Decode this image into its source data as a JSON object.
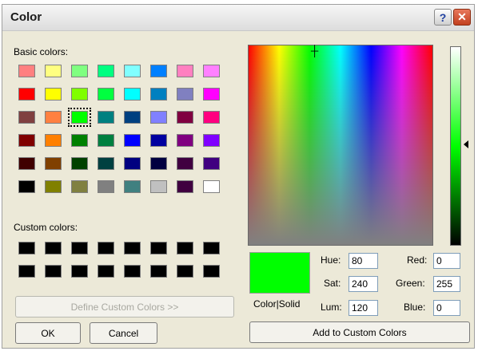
{
  "window": {
    "title": "Color"
  },
  "titlebar": {
    "help_glyph": "?",
    "close_glyph": "✕"
  },
  "basic_colors": {
    "label": "Basic colors:",
    "rows": [
      [
        "#ff8080",
        "#ffff80",
        "#80ff80",
        "#00ff80",
        "#80ffff",
        "#0080ff",
        "#ff80c0",
        "#ff80ff"
      ],
      [
        "#ff0000",
        "#ffff00",
        "#80ff00",
        "#00ff40",
        "#00ffff",
        "#0080c0",
        "#8080c0",
        "#ff00ff"
      ],
      [
        "#804040",
        "#ff8040",
        "#00ff00",
        "#008080",
        "#004080",
        "#8080ff",
        "#800040",
        "#ff0080"
      ],
      [
        "#800000",
        "#ff8000",
        "#008000",
        "#008040",
        "#0000ff",
        "#0000a0",
        "#800080",
        "#8000ff"
      ],
      [
        "#400000",
        "#804000",
        "#004000",
        "#004040",
        "#000080",
        "#000040",
        "#400040",
        "#400080"
      ],
      [
        "#000000",
        "#808000",
        "#808040",
        "#808080",
        "#408080",
        "#c0c0c0",
        "#400040",
        "#ffffff"
      ]
    ],
    "selected": [
      2,
      2
    ]
  },
  "custom_colors": {
    "label": "Custom colors:",
    "count": 16,
    "color": "#000000"
  },
  "buttons": {
    "define": "Define Custom Colors >>",
    "ok": "OK",
    "cancel": "Cancel",
    "add": "Add to Custom Colors"
  },
  "color_solid_label": "Color|Solid",
  "preview_color": "#00ff00",
  "hsl": {
    "hue_label": "Hue:",
    "hue": "80",
    "sat_label": "Sat:",
    "sat": "240",
    "lum_label": "Lum:",
    "lum": "120"
  },
  "rgb": {
    "red_label": "Red:",
    "red": "0",
    "green_label": "Green:",
    "green": "255",
    "blue_label": "Blue:",
    "blue": "0"
  }
}
